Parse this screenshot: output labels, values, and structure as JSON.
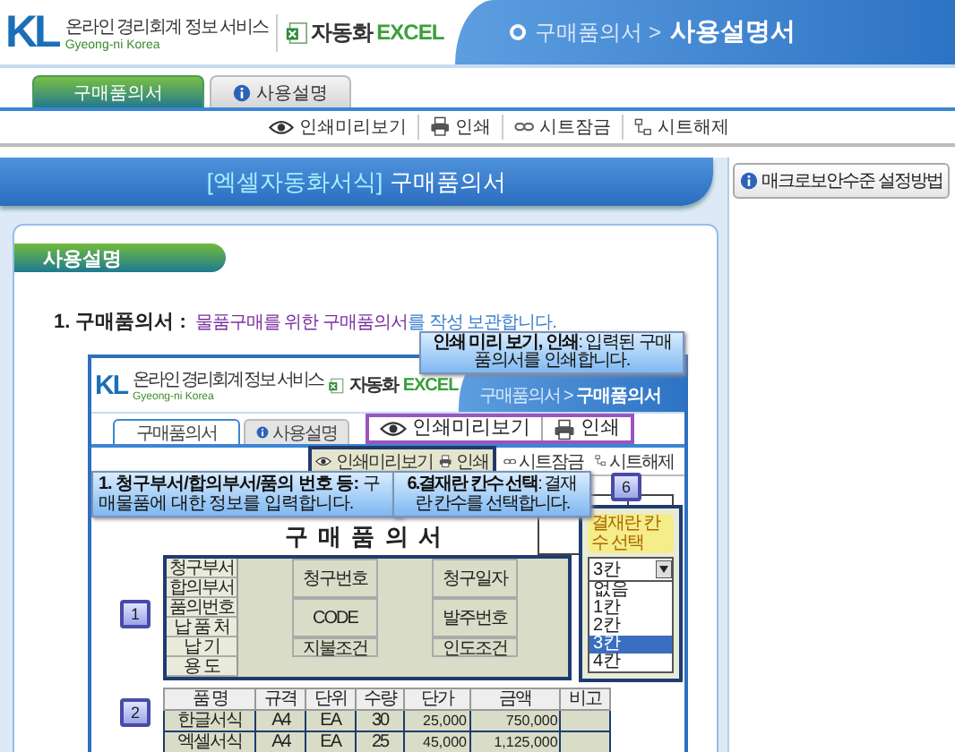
{
  "header": {
    "logo": "KL",
    "org_name": "온라인 경리회계 정보 서비스",
    "org_sub": "Gyeong-ni Korea",
    "product_prefix": "자동화",
    "product_name": "EXCEL",
    "breadcrumb_parent": "구매품의서 >",
    "breadcrumb_current": "사용설명서"
  },
  "tabs": [
    {
      "label": "구매품의서",
      "selected": true
    },
    {
      "label": "사용설명",
      "selected": false
    }
  ],
  "toolbar": [
    {
      "kind": "preview",
      "label": "인쇄미리보기"
    },
    {
      "kind": "print",
      "label": "인쇄"
    },
    {
      "kind": "lock",
      "label": "시트잠금"
    },
    {
      "kind": "unlock",
      "label": "시트해제"
    }
  ],
  "title_banner": {
    "category": "[엑셀자동화서식]",
    "title": "구매품의서"
  },
  "help_button": {
    "label": "매크로보안수준 설정방법"
  },
  "section": {
    "heading": "사용설명"
  },
  "step": {
    "number": "1. 구매품의서 :",
    "parts": [
      {
        "text": "물품구매를 위한 구매품의서",
        "emphasis": true
      },
      {
        "text": "를 작성 보관합니다.",
        "emphasis": false
      }
    ]
  },
  "example_screenshot": {
    "header": {
      "logo": "KL",
      "org_name": "온라인 경리회계 정보 서비스",
      "org_sub": "Gyeong-ni Korea",
      "product_prefix": "자동화",
      "product_name": "EXCEL",
      "breadcrumb_parent": "구매품의서 >",
      "breadcrumb_current": "구매품의서"
    },
    "tabs": [
      {
        "label": "구매품의서",
        "selected": true
      },
      {
        "label": "사용설명",
        "selected": false
      }
    ],
    "toolbar": [
      {
        "kind": "preview",
        "label": "인쇄미리보기"
      },
      {
        "kind": "print",
        "label": "인쇄"
      },
      {
        "kind": "lock",
        "label": "시트잠금"
      },
      {
        "kind": "unlock",
        "label": "시트해제"
      }
    ],
    "zoom_box": [
      {
        "kind": "preview",
        "label": "인쇄미리보기"
      },
      {
        "kind": "print",
        "label": "인쇄"
      }
    ],
    "form_title": "구 매 품 의 서",
    "info_labels": [
      "청구부서",
      "합의부서",
      "품의번호",
      "납 품 처",
      "납 기",
      "용 도"
    ],
    "middle_labels": [
      "청구번호",
      "CODE",
      "지불조건"
    ],
    "right_labels": [
      "청구일자",
      "발주번호",
      "인도조건"
    ],
    "items": {
      "columns": [
        "품 명",
        "규격",
        "단위",
        "수량",
        "단가",
        "금액",
        "비고"
      ],
      "rows": [
        [
          "한글서식",
          "A4",
          "EA",
          "30",
          "25,000",
          "750,000",
          ""
        ],
        [
          "엑셀서식",
          "A4",
          "EA",
          "25",
          "45,000",
          "1,125,000",
          ""
        ]
      ]
    },
    "callouts": [
      "**인쇄 미리 보기, 인쇄**: 입력된 구매 품의서를 인쇄합니다.",
      "**1. 청구부서/합의부서/품의 번호 등:** 구매물품에 대한 정보를 입력합니다.",
      "**6.결재란 칸수 선택**: 결재란 칸수를 선택합니다."
    ],
    "badges": [
      "6",
      "1",
      "2"
    ],
    "popup": {
      "label": "결재란 칸수 선택",
      "value": "3칸",
      "options": [
        {
          "label": "없음",
          "selected": false
        },
        {
          "label": "1칸",
          "selected": false
        },
        {
          "label": "2칸",
          "selected": false
        },
        {
          "label": "3칸",
          "selected": true
        },
        {
          "label": "4칸",
          "selected": false
        }
      ]
    }
  }
}
